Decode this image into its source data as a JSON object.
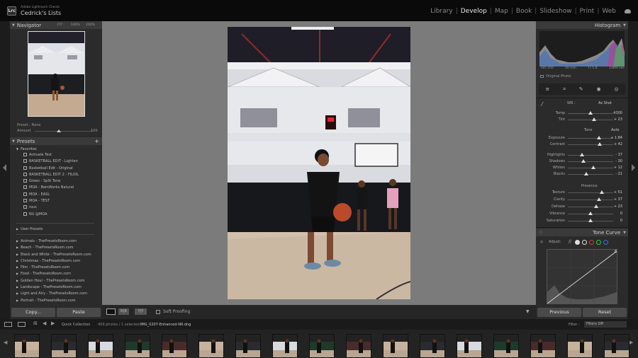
{
  "app": {
    "subtitle": "Adobe Lightroom Classic",
    "catalog": "Cedrick's Lists",
    "logo": "Lrc"
  },
  "modules": [
    "Library",
    "Develop",
    "Map",
    "Book",
    "Slideshow",
    "Print",
    "Web"
  ],
  "active_module": "Develop",
  "navigator": {
    "title": "Navigator",
    "zoom": [
      "FIT :",
      "100%",
      "200%"
    ]
  },
  "preset_amount": {
    "preset_label": "Preset : None",
    "amount_label": "Amount",
    "amount_value": "100"
  },
  "presets": {
    "title": "Presets",
    "favorites_label": "Favorites",
    "favorites": [
      "Activate Test",
      "BASKETBALL EDIT - Lighten",
      "Basketball Edit - Original",
      "BASKETBALL EDIT 2 - FILOIL",
      "Green - Split Tone",
      "MOA - BamWorks Natural",
      "MOA - EASL",
      "MOA - TEST",
      "rous",
      "NU @MOA"
    ],
    "user_presets_label": "User Presets",
    "groups": [
      "Animals - ThePresetsRoom.com",
      "Beach - ThePresetsRoom.com",
      "Black and White - ThePresetsRoom.com",
      "Christmas - ThePresetsRoom.com",
      "Film - ThePresetsRoom.com",
      "Food - ThePresetsRoom.com",
      "Golden Hour - ThePresetsRoom.com",
      "Landscape - ThePresetsRoom.com",
      "Light and Airy - ThePresetsRoom.com",
      "Portrait - ThePresetsRoom.com"
    ]
  },
  "left_buttons": {
    "copy": "Copy...",
    "paste": "Paste"
  },
  "toolbar": {
    "soft_proofing": "Soft Proofing",
    "view_label": "Y|Y"
  },
  "histogram": {
    "title": "Histogram",
    "exif": [
      "ISO 250",
      "50 mm",
      "f / 1.8",
      "1/800 sec"
    ],
    "original_photo": "Original Photo"
  },
  "basic": {
    "wb_label": "WB :",
    "wb_value": "As Shot",
    "tone_label": "Tone",
    "auto_label": "Auto",
    "presence_label": "Presence",
    "wb_sliders": [
      {
        "label": "Temp",
        "value": "4300",
        "pos": 0.5
      },
      {
        "label": "Tint",
        "value": "+ 23",
        "pos": 0.58
      }
    ],
    "tone_sliders": [
      {
        "label": "Exposure",
        "value": "+ 1.84",
        "pos": 0.68
      },
      {
        "label": "Contrast",
        "value": "+ 42",
        "pos": 0.7
      }
    ],
    "tone_sliders2": [
      {
        "label": "Highlights",
        "value": "- 37",
        "pos": 0.32
      },
      {
        "label": "Shadows",
        "value": "- 30",
        "pos": 0.35
      },
      {
        "label": "Whites",
        "value": "+ 12",
        "pos": 0.56
      },
      {
        "label": "Blacks",
        "value": "- 21",
        "pos": 0.4
      }
    ],
    "presence_sliders": [
      {
        "label": "Texture",
        "value": "+ 51",
        "pos": 0.75
      },
      {
        "label": "Clarity",
        "value": "+ 37",
        "pos": 0.68
      },
      {
        "label": "Dehaze",
        "value": "+ 23",
        "pos": 0.62
      },
      {
        "label": "Vibrance",
        "value": "0",
        "pos": 0.5
      },
      {
        "label": "Saturation",
        "value": "0",
        "pos": 0.5
      }
    ]
  },
  "tone_curve": {
    "title": "Tone Curve",
    "adjust_label": "Adjust:"
  },
  "right_buttons": {
    "previous": "Previous",
    "reset": "Reset"
  },
  "filmbar": {
    "source": "Quick Collection",
    "count": "409 photos / 1 selected /",
    "filename": "IMG_0207-Enhanced-NR.dng",
    "filter_label": "Filter :",
    "filter_value": "Filters Off"
  },
  "colors": {
    "accent": "#e8e8e8",
    "panel": "#2b2b2b",
    "canvas": "#7b7b7b"
  }
}
